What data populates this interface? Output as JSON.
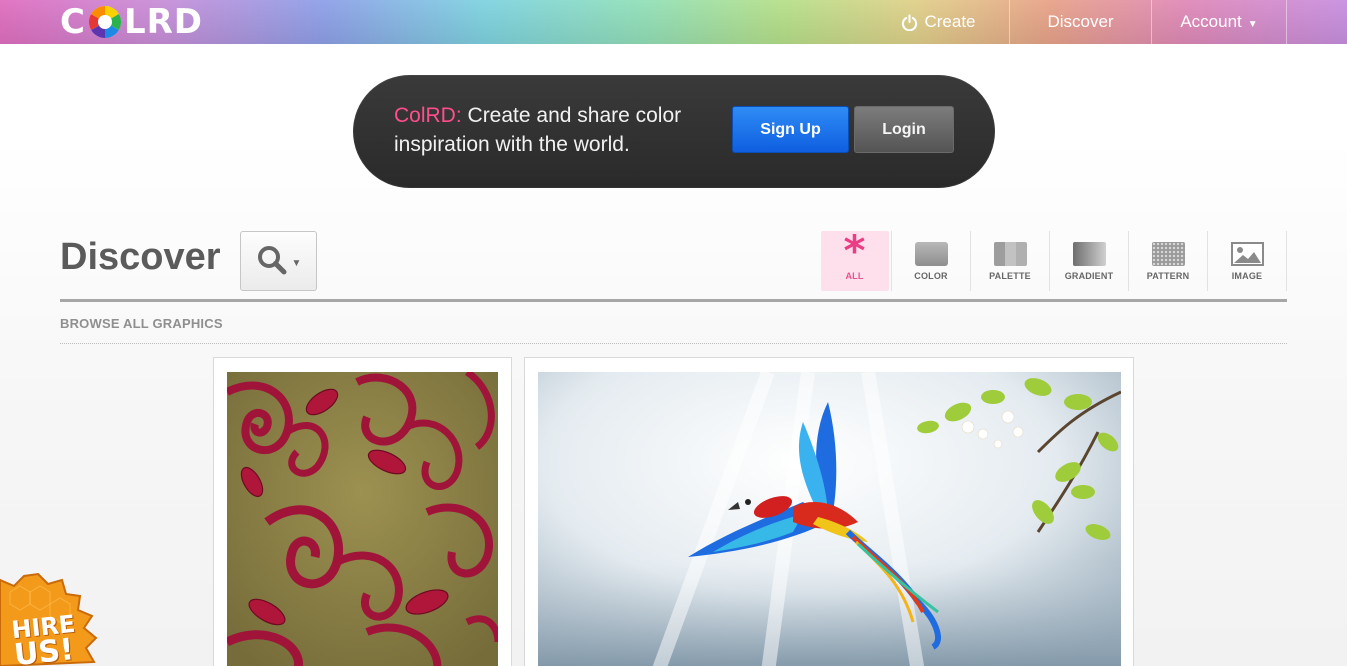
{
  "header": {
    "logo_text_left": "C",
    "logo_text_right": "LRD",
    "nav": {
      "create": "Create",
      "discover": "Discover",
      "account": "Account"
    }
  },
  "banner": {
    "brand": "ColRD:",
    "tagline": " Create and share color inspiration with the world.",
    "signup_label": "Sign Up",
    "login_label": "Login"
  },
  "discover": {
    "title": "Discover",
    "filters": [
      {
        "label": "ALL",
        "icon": "asterisk-icon",
        "active": true
      },
      {
        "label": "COLOR",
        "icon": "color-swatch-icon",
        "active": false
      },
      {
        "label": "PALETTE",
        "icon": "palette-icon",
        "active": false
      },
      {
        "label": "GRADIENT",
        "icon": "gradient-icon",
        "active": false
      },
      {
        "label": "PATTERN",
        "icon": "pattern-icon",
        "active": false
      },
      {
        "label": "IMAGE",
        "icon": "image-icon",
        "active": false
      }
    ],
    "browse_label": "BROWSE ALL GRAPHICS"
  },
  "gallery": [
    {
      "kind": "pattern",
      "subject": "red damask floral pattern"
    },
    {
      "kind": "image",
      "subject": "macaw parrot in flight"
    }
  ],
  "badge": {
    "text_line1": "HIRE",
    "text_line2": "US!"
  },
  "colors": {
    "brand_pink": "#ff4d8d",
    "signup_blue": "#1a6fe8",
    "active_filter_bg": "#fde0ec"
  }
}
